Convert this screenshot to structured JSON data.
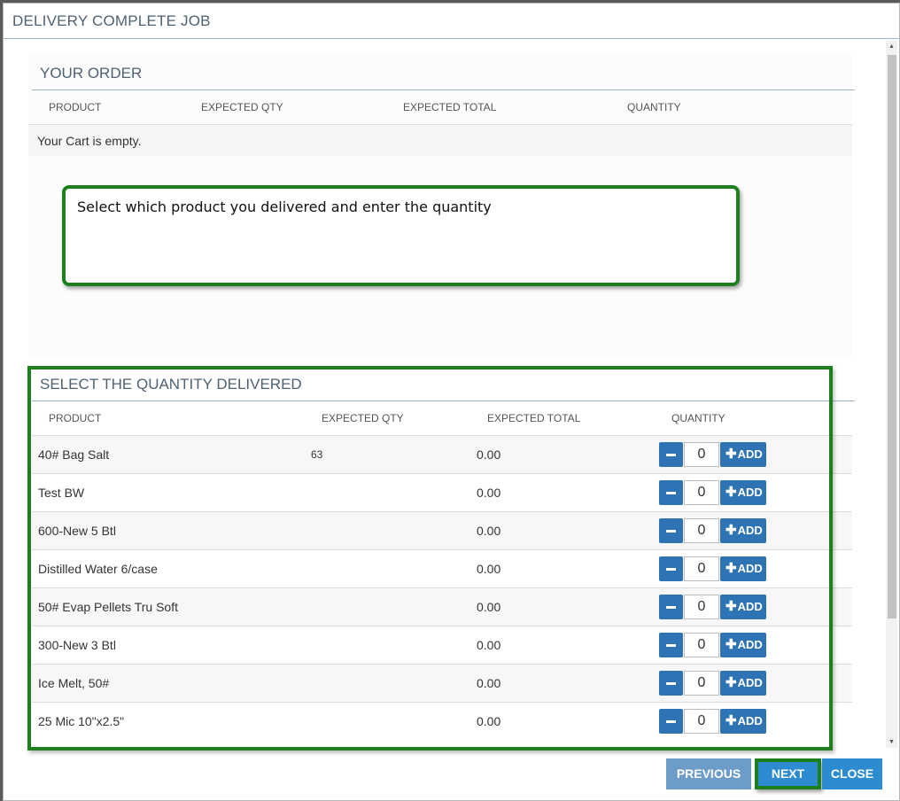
{
  "dialog": {
    "title": "DELIVERY COMPLETE JOB"
  },
  "order": {
    "title": "YOUR ORDER",
    "columns": [
      "PRODUCT",
      "EXPECTED QTY",
      "EXPECTED TOTAL",
      "QUANTITY"
    ],
    "empty_text": "Your Cart is empty."
  },
  "callout": {
    "text": "Select which product you delivered and enter the quantity"
  },
  "delivered": {
    "title": "SELECT THE QUANTITY DELIVERED",
    "columns": [
      "PRODUCT",
      "EXPECTED QTY",
      "EXPECTED TOTAL",
      "QUANTITY"
    ],
    "add_label": "ADD",
    "rows": [
      {
        "product": "40# Bag Salt",
        "expected_qty": "63",
        "expected_total": "0.00",
        "quantity": "0"
      },
      {
        "product": "Test BW",
        "expected_qty": "",
        "expected_total": "0.00",
        "quantity": "0"
      },
      {
        "product": "600-New 5 Btl",
        "expected_qty": "",
        "expected_total": "0.00",
        "quantity": "0"
      },
      {
        "product": "Distilled Water 6/case",
        "expected_qty": "",
        "expected_total": "0.00",
        "quantity": "0"
      },
      {
        "product": "50# Evap Pellets Tru Soft",
        "expected_qty": "",
        "expected_total": "0.00",
        "quantity": "0"
      },
      {
        "product": "300-New 3 Btl",
        "expected_qty": "",
        "expected_total": "0.00",
        "quantity": "0"
      },
      {
        "product": "Ice Melt, 50#",
        "expected_qty": "",
        "expected_total": "0.00",
        "quantity": "0"
      },
      {
        "product": "25 Mic 10\"x2.5\"",
        "expected_qty": "",
        "expected_total": "0.00",
        "quantity": "0"
      }
    ]
  },
  "footer": {
    "previous_label": "PREVIOUS",
    "next_label": "NEXT",
    "close_label": "CLOSE"
  },
  "icons": {
    "minus": "minus-icon",
    "plus": "plus-icon",
    "scroll_up": "scroll-up-arrow-icon",
    "scroll_down": "scroll-down-arrow-icon"
  },
  "colors": {
    "primary_button": "#2e74b5",
    "highlight": "#1e7f1e",
    "heading": "#4f6173"
  }
}
